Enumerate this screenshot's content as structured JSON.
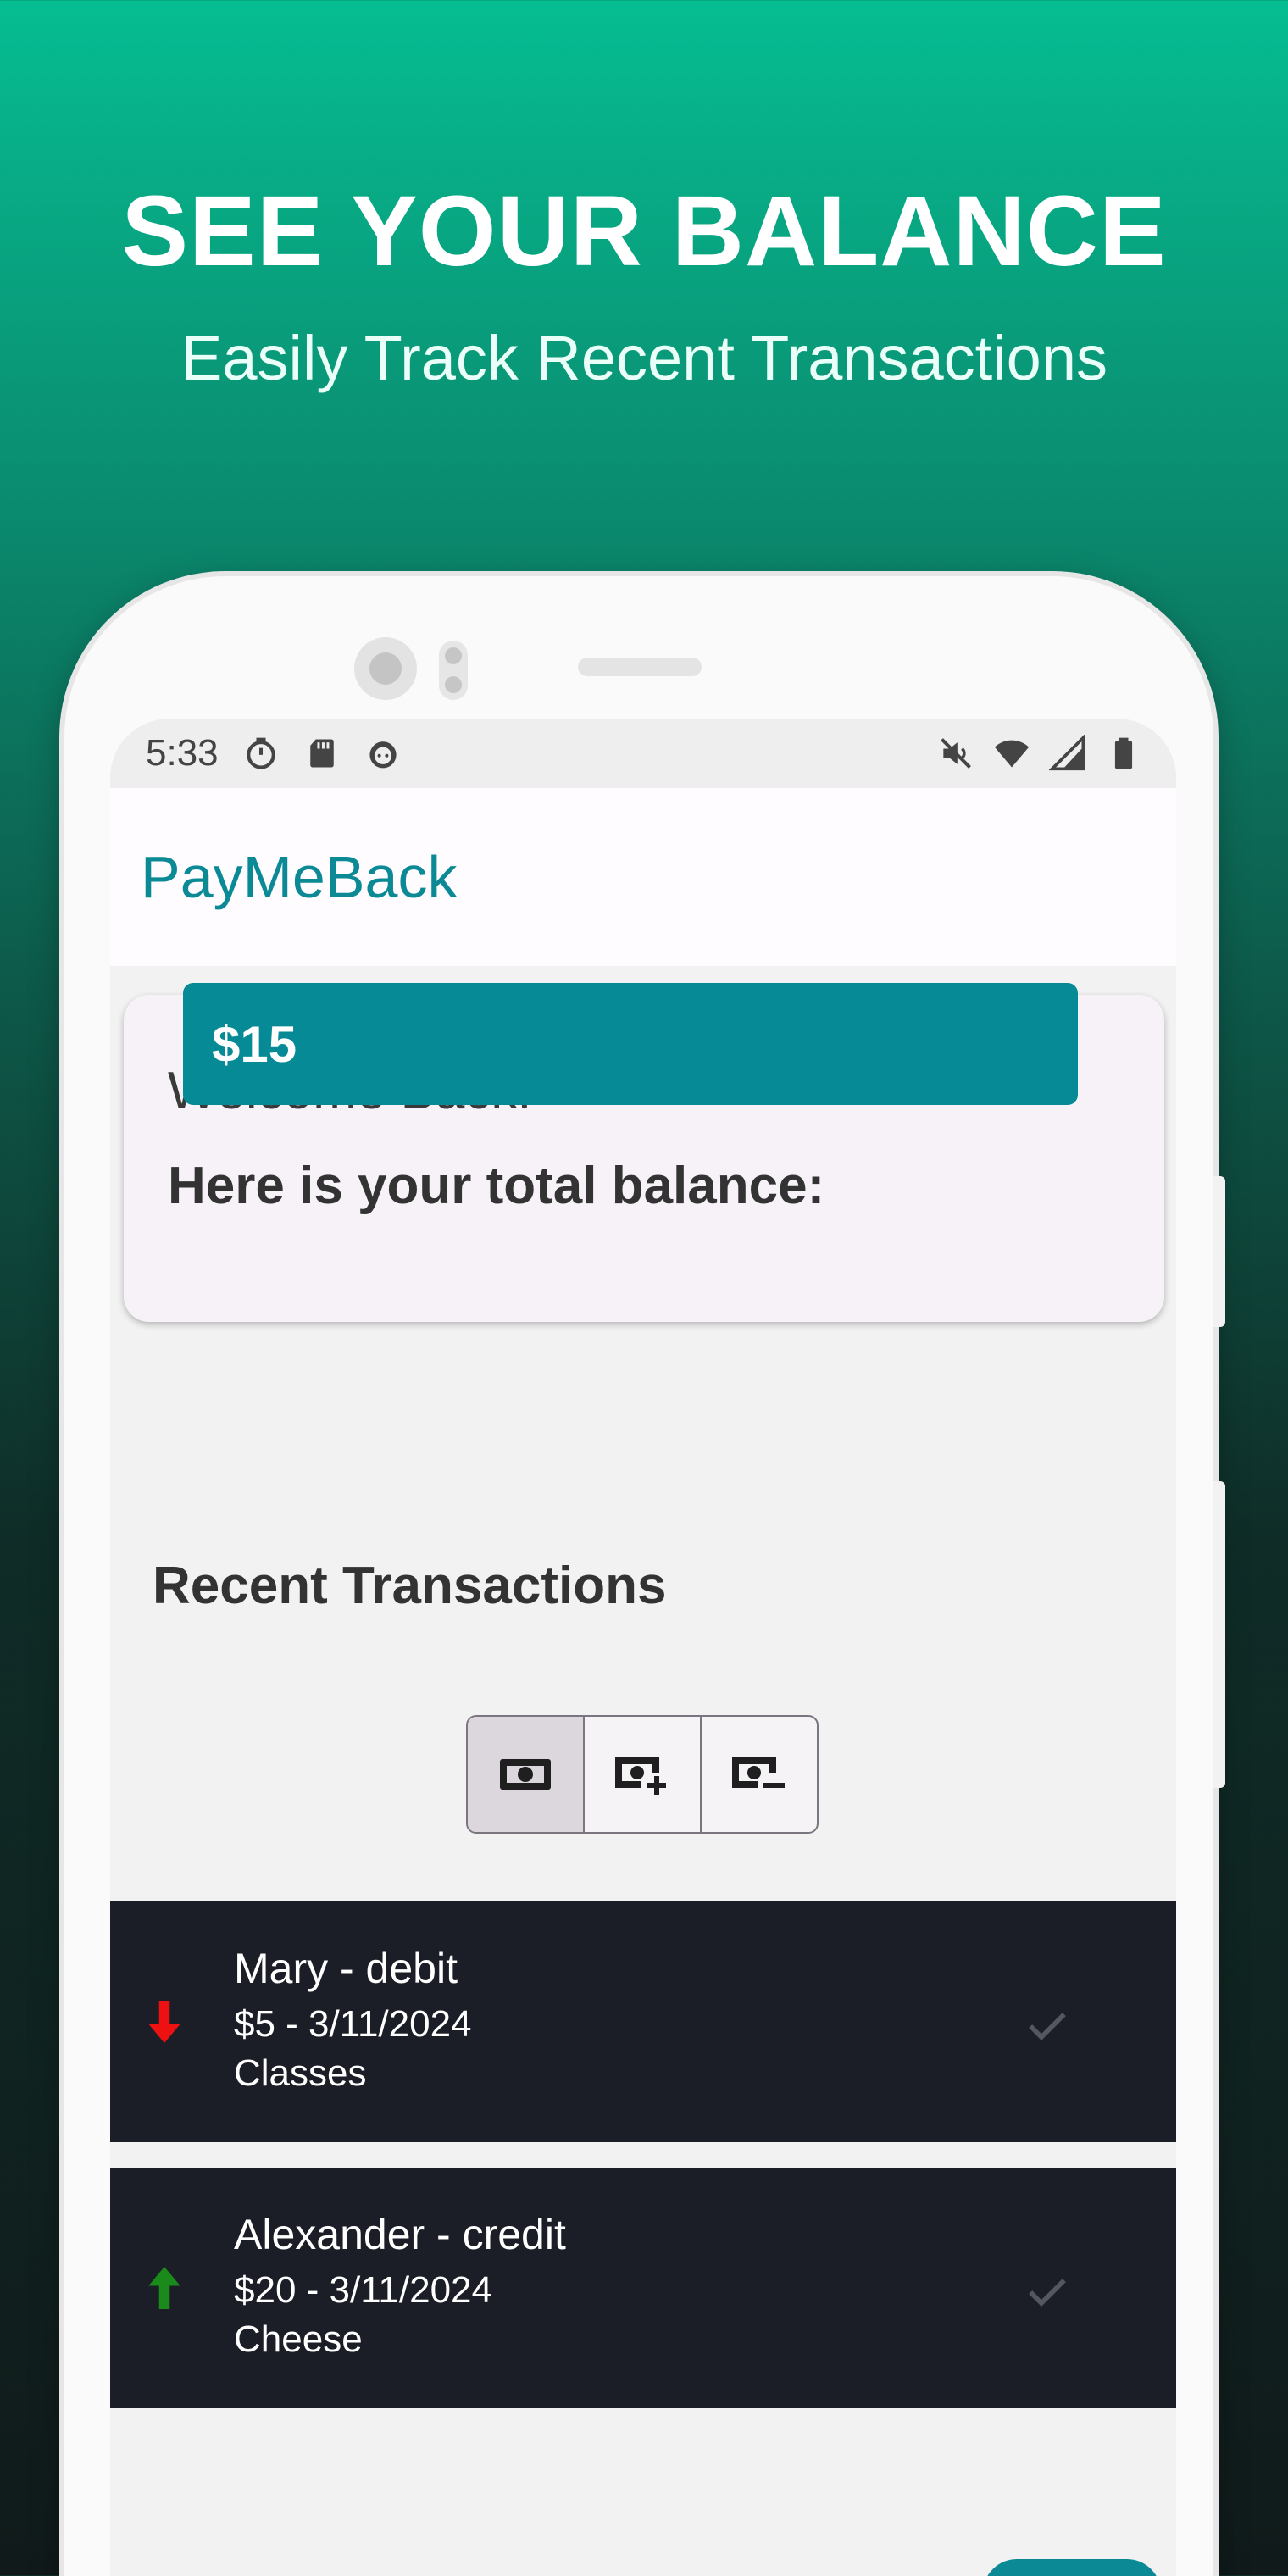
{
  "promo": {
    "title": "SEE YOUR BALANCE",
    "subtitle": "Easily Track Recent Transactions"
  },
  "status_bar": {
    "time": "5:33",
    "left_icons": [
      "timer-icon",
      "sd-card-icon",
      "android-face-icon"
    ],
    "right_icons": [
      "mute-icon",
      "wifi-icon",
      "signal-icon",
      "battery-icon"
    ]
  },
  "app": {
    "title": "PayMeBack",
    "accent_color": "#0b8a96"
  },
  "balance_card": {
    "welcome": "Welcome Back!",
    "label": "Here is your total balance:",
    "amount": "$15"
  },
  "transactions_section": {
    "title": "Recent Transactions",
    "filters": [
      {
        "icon": "cash-icon",
        "selected": true
      },
      {
        "icon": "cash-plus-icon",
        "selected": false
      },
      {
        "icon": "cash-minus-icon",
        "selected": false
      }
    ],
    "items": [
      {
        "name": "Mary - debit",
        "amount_date": "$5 - 3/11/2024",
        "note": "Classes",
        "direction": "down",
        "arrow_color": "#ee1111"
      },
      {
        "name": "Alexander - credit",
        "amount_date": "$20 - 3/11/2024",
        "note": "Cheese",
        "direction": "up",
        "arrow_color": "#1a8a1a"
      }
    ]
  }
}
